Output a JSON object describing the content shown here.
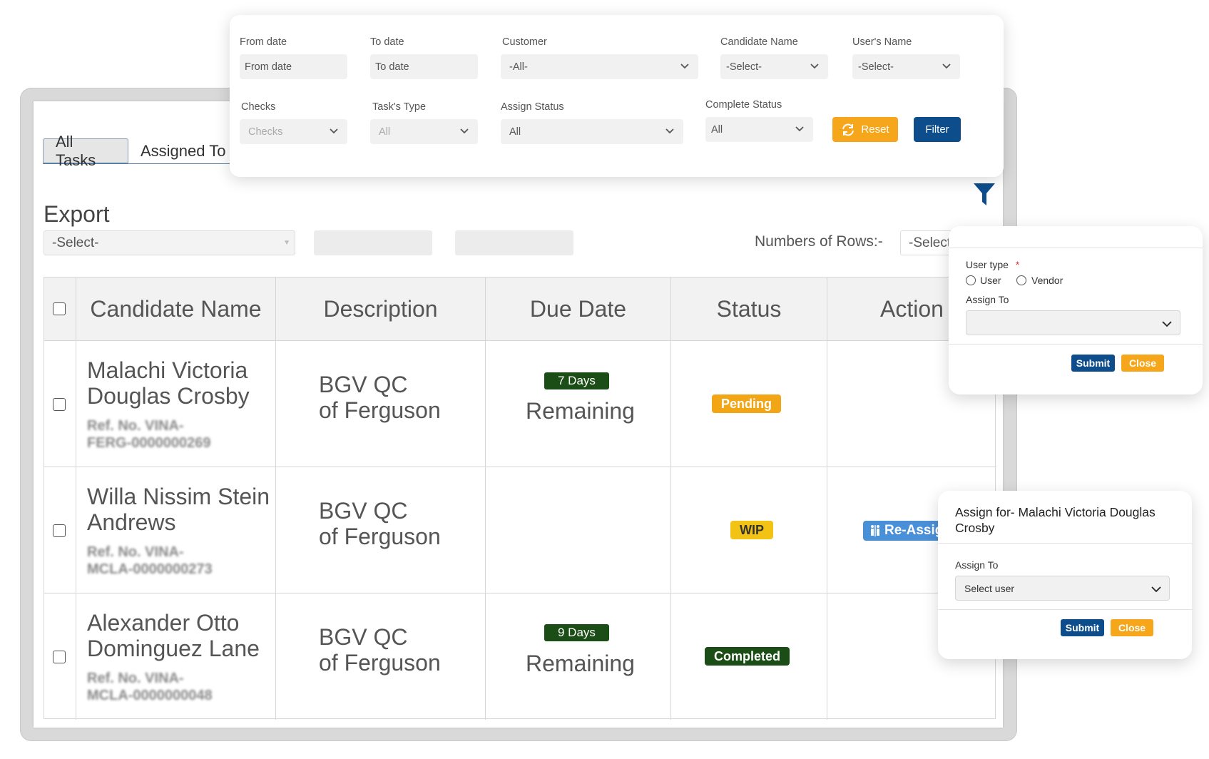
{
  "tabs": {
    "all": "All Tasks",
    "assigned": "Assigned To"
  },
  "export": {
    "label": "Export",
    "select_value": "-Select-"
  },
  "rows": {
    "label": "Numbers of Rows:-",
    "select_value": "-Select-"
  },
  "table": {
    "headers": {
      "candidate": "Candidate Name",
      "description": "Description",
      "due": "Due Date",
      "status": "Status",
      "action": "Action"
    },
    "rows": [
      {
        "name_line1": "Malachi Victoria",
        "name_line2": "Douglas Crosby",
        "ref_line1": "Ref. No. VINA-",
        "ref_line2": "FERG-0000000269",
        "desc_line1": "BGV QC",
        "desc_line2": "of Ferguson",
        "days": "7 Days",
        "remaining": "Remaining",
        "status": "Pending",
        "action": ""
      },
      {
        "name_line1": "Willa Nissim Stein",
        "name_line2": "Andrews",
        "ref_line1": "Ref. No. VINA-",
        "ref_line2": "MCLA-0000000273",
        "desc_line1": "BGV QC",
        "desc_line2": "of Ferguson",
        "days": "",
        "remaining": "",
        "status": "WIP",
        "action": "Re-Assign"
      },
      {
        "name_line1": "Alexander Otto",
        "name_line2": "Dominguez Lane",
        "ref_line1": "Ref. No. VINA-",
        "ref_line2": "MCLA-0000000048",
        "desc_line1": "BGV QC",
        "desc_line2": "of Ferguson",
        "days": "9 Days",
        "remaining": "Remaining",
        "status": "Completed",
        "action": ""
      }
    ]
  },
  "filter_panel": {
    "from_date": {
      "label": "From date",
      "placeholder": "From date"
    },
    "to_date": {
      "label": "To date",
      "placeholder": "To date"
    },
    "customer": {
      "label": "Customer",
      "value": "-All-"
    },
    "candidate_name": {
      "label": "Candidate Name",
      "value": "-Select-"
    },
    "users_name": {
      "label": "User's Name",
      "value": "-Select-"
    },
    "checks": {
      "label": "Checks",
      "value": "Checks"
    },
    "task_type": {
      "label": "Task's Type",
      "value": "All"
    },
    "assign_status": {
      "label": "Assign Status",
      "value": "All"
    },
    "complete_status": {
      "label": "Complete Status",
      "value": "All"
    },
    "reset_label": "Reset",
    "filter_label": "Filter"
  },
  "usertype_popup": {
    "user_type_label": "User type",
    "required_mark": "*",
    "option_user": "User",
    "option_vendor": "Vendor",
    "assign_to_label": "Assign To",
    "assign_to_value": "",
    "submit_label": "Submit",
    "close_label": "Close"
  },
  "assign_popup": {
    "title": "Assign for- Malachi Victoria Douglas Crosby",
    "assign_to_label": "Assign To",
    "assign_to_value": "Select user",
    "submit_label": "Submit",
    "close_label": "Close"
  },
  "colors": {
    "primary": "#0d4d8c",
    "orange": "#f5a61a",
    "pending": "#f2a515",
    "wip": "#f2c215",
    "completed": "#1b4d16",
    "reassign": "#4a90d9"
  },
  "icons": [
    "filter-funnel-icon",
    "refresh-icon",
    "chevron-down-icon",
    "reassign-icon"
  ]
}
